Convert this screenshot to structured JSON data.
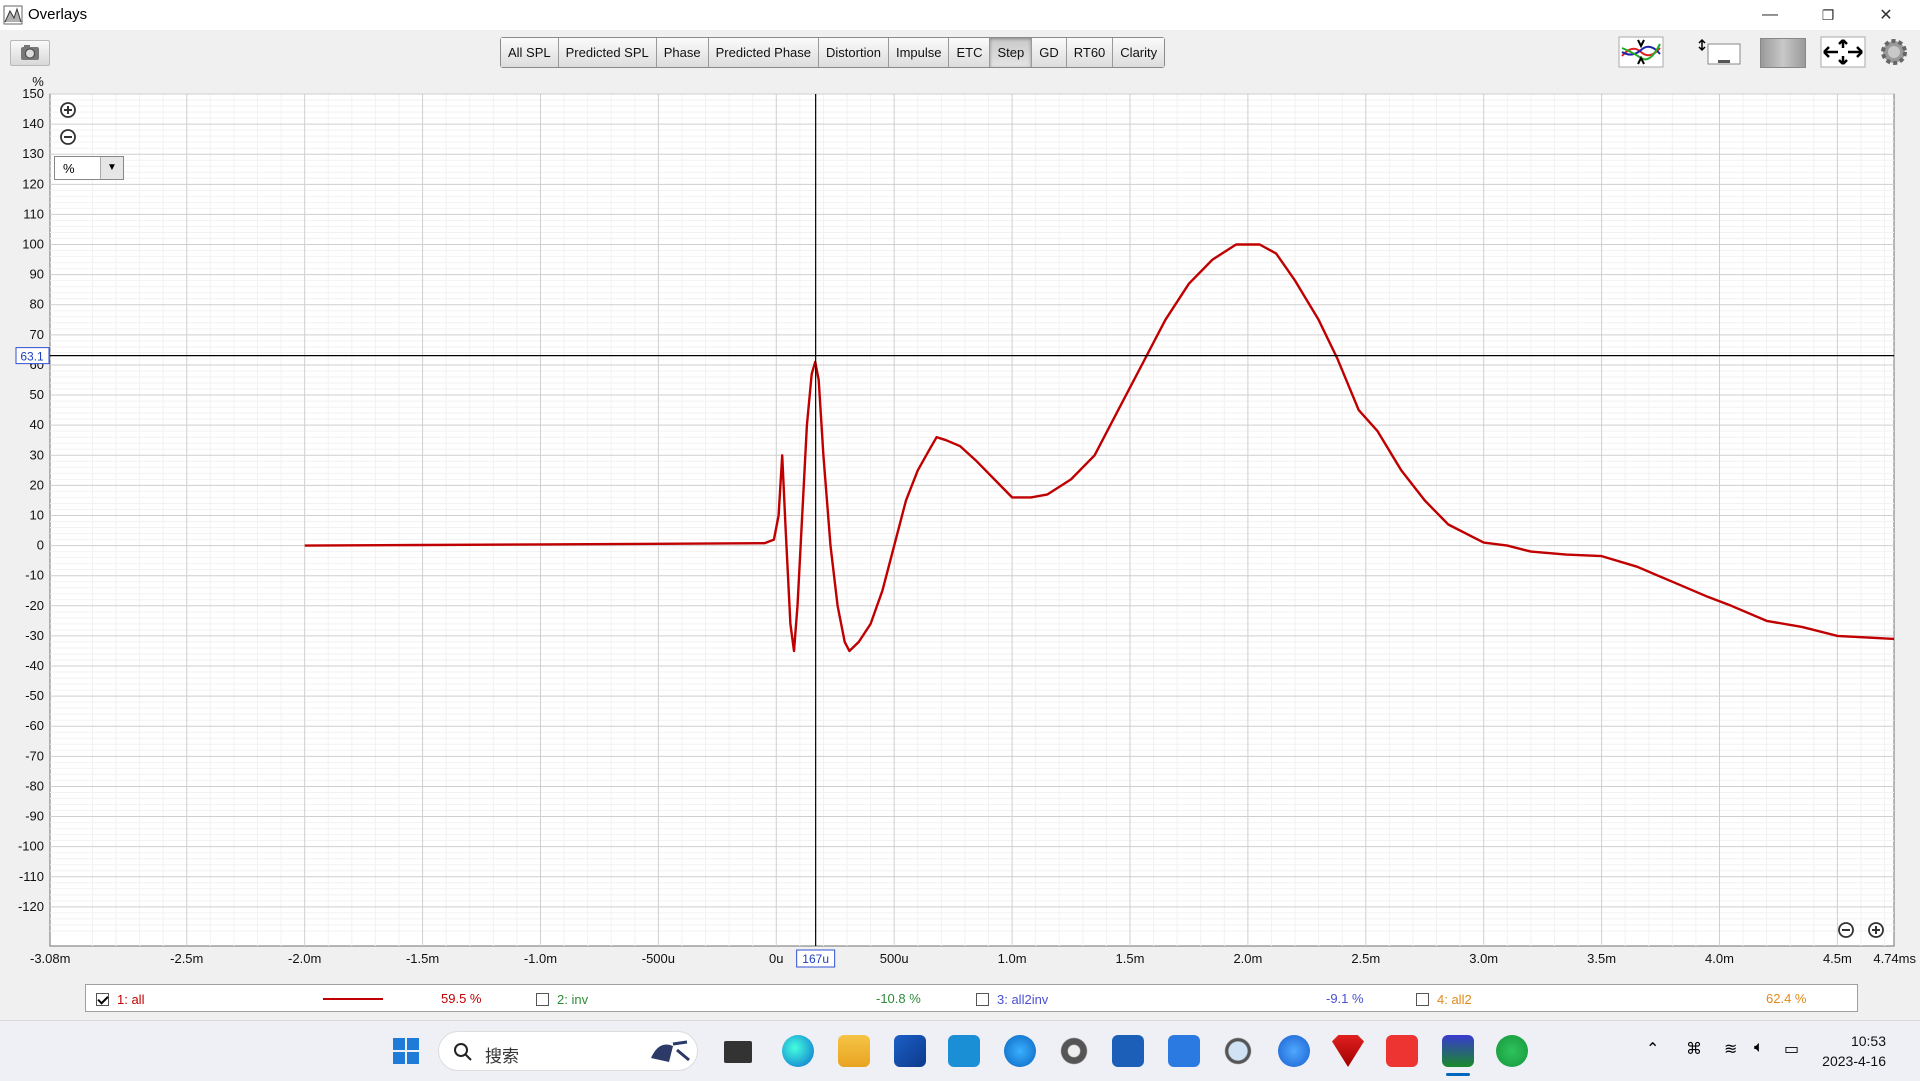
{
  "window": {
    "title": "Overlays",
    "minimize": "—",
    "restore": "❐",
    "close": "✕"
  },
  "toolbar": {
    "tabs": [
      {
        "label": "All SPL",
        "active": false
      },
      {
        "label": "Predicted SPL",
        "active": false
      },
      {
        "label": "Phase",
        "active": false
      },
      {
        "label": "Predicted Phase",
        "active": false
      },
      {
        "label": "Distortion",
        "active": false
      },
      {
        "label": "Impulse",
        "active": false
      },
      {
        "label": "ETC",
        "active": false
      },
      {
        "label": "Step",
        "active": true
      },
      {
        "label": "GD",
        "active": false
      },
      {
        "label": "RT60",
        "active": false
      },
      {
        "label": "Clarity",
        "active": false
      }
    ]
  },
  "plot": {
    "unit_label": "%",
    "unit_dropdown": "%",
    "cursor_y_label": "63.1",
    "cursor_x_label": "167u",
    "y_ticks": [
      150,
      140,
      130,
      120,
      110,
      100,
      90,
      80,
      70,
      60,
      50,
      40,
      30,
      20,
      10,
      0,
      -10,
      -20,
      -30,
      -40,
      -50,
      -60,
      -70,
      -80,
      -90,
      -100,
      -110,
      -120
    ],
    "x_ticks": [
      {
        "v": -3.08,
        "label": "-3.08m"
      },
      {
        "v": -2.5,
        "label": "-2.5m"
      },
      {
        "v": -2.0,
        "label": "-2.0m"
      },
      {
        "v": -1.5,
        "label": "-1.5m"
      },
      {
        "v": -1.0,
        "label": "-1.0m"
      },
      {
        "v": -0.5,
        "label": "-500u"
      },
      {
        "v": 0.0,
        "label": "0u"
      },
      {
        "v": 0.5,
        "label": "500u"
      },
      {
        "v": 1.0,
        "label": "1.0m"
      },
      {
        "v": 1.5,
        "label": "1.5m"
      },
      {
        "v": 2.0,
        "label": "2.0m"
      },
      {
        "v": 2.5,
        "label": "2.5m"
      },
      {
        "v": 3.0,
        "label": "3.0m"
      },
      {
        "v": 3.5,
        "label": "3.5m"
      },
      {
        "v": 4.0,
        "label": "4.0m"
      },
      {
        "v": 4.5,
        "label": "4.5m"
      },
      {
        "v": 4.74,
        "label": "4.74ms"
      }
    ],
    "x_range_ms": [
      -3.08,
      4.74
    ],
    "y_range": [
      -133,
      150
    ],
    "cursor_x_ms": 0.167,
    "cursor_y": 63.1,
    "trace_color": "#c00000",
    "step_trace": [
      [
        -2.0,
        0
      ],
      [
        -1.5,
        0.2
      ],
      [
        -1.0,
        0.4
      ],
      [
        -0.5,
        0.6
      ],
      [
        -0.05,
        0.8
      ],
      [
        -0.01,
        2
      ],
      [
        0.01,
        10
      ],
      [
        0.025,
        30
      ],
      [
        0.04,
        5
      ],
      [
        0.06,
        -26
      ],
      [
        0.075,
        -35
      ],
      [
        0.09,
        -20
      ],
      [
        0.11,
        10
      ],
      [
        0.13,
        40
      ],
      [
        0.15,
        57
      ],
      [
        0.165,
        61
      ],
      [
        0.18,
        55
      ],
      [
        0.2,
        30
      ],
      [
        0.23,
        0
      ],
      [
        0.26,
        -20
      ],
      [
        0.29,
        -32
      ],
      [
        0.31,
        -35
      ],
      [
        0.35,
        -32
      ],
      [
        0.4,
        -26
      ],
      [
        0.45,
        -15
      ],
      [
        0.5,
        0
      ],
      [
        0.55,
        15
      ],
      [
        0.6,
        25
      ],
      [
        0.65,
        32
      ],
      [
        0.68,
        36
      ],
      [
        0.72,
        35
      ],
      [
        0.78,
        33
      ],
      [
        0.85,
        28
      ],
      [
        0.95,
        20
      ],
      [
        1.0,
        16
      ],
      [
        1.08,
        16
      ],
      [
        1.15,
        17
      ],
      [
        1.25,
        22
      ],
      [
        1.35,
        30
      ],
      [
        1.45,
        45
      ],
      [
        1.55,
        60
      ],
      [
        1.65,
        75
      ],
      [
        1.75,
        87
      ],
      [
        1.85,
        95
      ],
      [
        1.95,
        100
      ],
      [
        2.05,
        100
      ],
      [
        2.12,
        97
      ],
      [
        2.2,
        88
      ],
      [
        2.3,
        75
      ],
      [
        2.38,
        62
      ],
      [
        2.47,
        45
      ],
      [
        2.55,
        38
      ],
      [
        2.65,
        25
      ],
      [
        2.75,
        15
      ],
      [
        2.85,
        7
      ],
      [
        3.0,
        1
      ],
      [
        3.1,
        0
      ],
      [
        3.2,
        -2
      ],
      [
        3.35,
        -3
      ],
      [
        3.5,
        -3.5
      ],
      [
        3.65,
        -7
      ],
      [
        3.8,
        -12
      ],
      [
        3.95,
        -17
      ],
      [
        4.05,
        -20
      ],
      [
        4.2,
        -25
      ],
      [
        4.35,
        -27
      ],
      [
        4.5,
        -30
      ],
      [
        4.74,
        -31
      ]
    ]
  },
  "legend": [
    {
      "checked": true,
      "label": "1: all",
      "value": "59.5 %",
      "color": "#c00000"
    },
    {
      "checked": false,
      "label": "2: inv",
      "value": "-10.8 %",
      "color": "#2e8b3a"
    },
    {
      "checked": false,
      "label": "3: all2inv",
      "value": "-9.1 %",
      "color": "#4a50d0"
    },
    {
      "checked": false,
      "label": "4: all2",
      "value": "62.4 %",
      "color": "#e08a1a"
    }
  ],
  "taskbar": {
    "search_placeholder": "搜索",
    "time": "10:53",
    "date": "2023-4-16"
  }
}
